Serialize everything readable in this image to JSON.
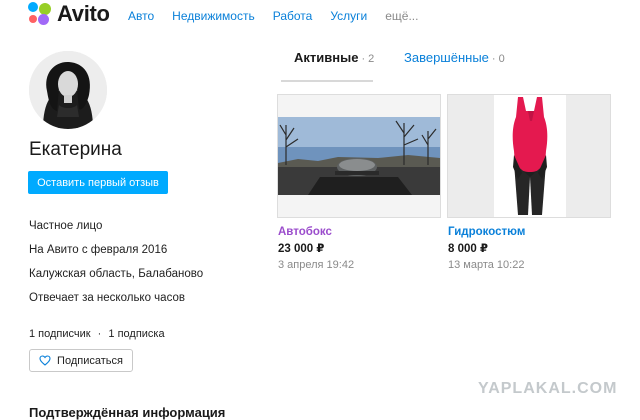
{
  "header": {
    "logo_text": "Avito",
    "logo_colors": [
      "#00aaff",
      "#97cf26",
      "#a169f7",
      "#ff6163"
    ],
    "nav": [
      "Авто",
      "Недвижимость",
      "Работа",
      "Услуги",
      "ещё..."
    ]
  },
  "profile": {
    "name": "Екатерина",
    "review_button": "Оставить первый отзыв",
    "info": [
      "Частное лицо",
      "На Авито с февраля 2016",
      "Калужская область, Балабаново",
      "Отвечает за несколько часов"
    ],
    "subscribers": "1 подписчик",
    "subscriptions": "1 подписка",
    "subscribe_button": "Подписаться",
    "verified_heading": "Подтверждённая информация"
  },
  "tabs": {
    "active": {
      "label": "Активные",
      "count": "2"
    },
    "done": {
      "label": "Завершённые",
      "count": "0"
    }
  },
  "listings": [
    {
      "title": "Автобокс",
      "title_color": "#9b4dcc",
      "price": "23 000 ₽",
      "date": "3 апреля 19:42"
    },
    {
      "title": "Гидрокостюм",
      "title_color": "#0a80d9",
      "price": "8 000 ₽",
      "date": "13 марта 10:22"
    }
  ],
  "watermark": "YAPLAKAL.COM"
}
